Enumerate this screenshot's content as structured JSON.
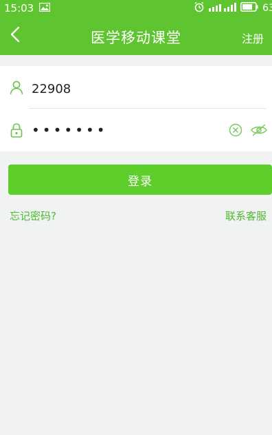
{
  "status_bar": {
    "time": "15:03",
    "battery": "63",
    "icons": [
      "gallery-icon",
      "alarm-icon",
      "signal-icon",
      "battery-icon"
    ]
  },
  "header": {
    "title": "医学移动课堂",
    "register_label": "注册",
    "back_icon": "chevron-left-icon",
    "background_color": "#5ec42f"
  },
  "login_form": {
    "username": {
      "icon": "user-icon",
      "value": "22908"
    },
    "password": {
      "icon": "lock-icon",
      "value": "•••••••",
      "clear_icon": "clear-circle-icon",
      "visibility_icon": "eye-off-icon"
    },
    "submit_label": "登录",
    "accent_color": "#5ecf2a"
  },
  "links": {
    "forgot_password": "忘记密码?",
    "contact_support": "联系客服"
  }
}
